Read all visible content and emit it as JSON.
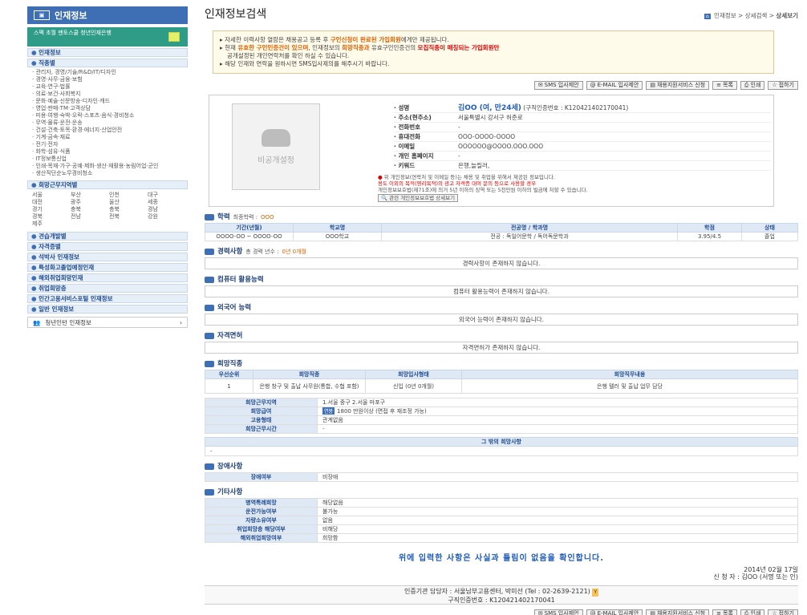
{
  "sidebar": {
    "title": "인재정보",
    "title_icon": "image-icon",
    "banner": "스펙 초월 멘토스쿨 청년인재은행",
    "sections": {
      "talent": "인재정보",
      "job_type": "직종별",
      "region": "희망근무지역별",
      "apprentice": "견습개발별",
      "license": "자격증별",
      "master": "석박사 인재정보",
      "specialized": "특성화고졸업예정인재",
      "overseas": "해외취업희망인재",
      "reemployment": "취업희망층",
      "hanaro": "인간고용서비스포털 인재정보",
      "elderly": "일반 인재정보"
    },
    "job_types": [
      "관리자, 경영/기술/R&D/IT/디자인",
      "경영·사무·금융·보험",
      "교육·연구·법률",
      "의료·보건·사회복지",
      "문화·예술·신문방송·디자인·캐드",
      "영업·판매·TM·고객상담",
      "미용·여행·숙박·오락·스포츠·음식·경비청소",
      "무역·물류·운전·운송",
      "건설·건축·토목·환경·에너지·산업안전",
      "기계·금속·재료",
      "전기·전자",
      "화학·섬유·식품",
      "IT정보통신업",
      "인쇄·목재·가구·공예·제화·생산·재활용·농림어업·군인",
      "생산직단순노무경비청소"
    ],
    "regions": [
      "서울",
      "부산",
      "인천",
      "대구",
      "대전",
      "광주",
      "울산",
      "세종",
      "경기",
      "충북",
      "충북",
      "경남",
      "경북",
      "전남",
      "전북",
      "강원",
      "제주"
    ],
    "youth_link": "청년인턴 인재정보"
  },
  "header": {
    "title": "인재정보검색",
    "breadcrumb": [
      "인재정보",
      "상세검색",
      "상세보기"
    ]
  },
  "notice": {
    "line1_pre": "자세한 이력사항 열람은 채용공고 등록 후",
    "line1_hl": "구인신청이 완료된 가입회원",
    "line1_post": "에게만 제공됩니다.",
    "line2_pre": "현재",
    "line2_hl1": "유효한 구인인증건이 있으며",
    "line2_mid": ", 인재정보의",
    "line2_hl2": "희망직종과",
    "line2_mid2": "유효구인인증건의",
    "line2_hl3": "모집직종이 매칭되는 가입회원만",
    "line2_post": "공개설정된 개인연락처를 확인 하실 수 있습니다.",
    "line3": "해당 인재와 연락을 원하시면 SMS입사제의를 해주시기 바랍니다."
  },
  "buttons": {
    "sms": "SMS 입사제안",
    "email": "E-MAIL 입사제안",
    "support": "채용지원서비스 신청",
    "list": "목록",
    "print": "인쇄",
    "close": "접하기"
  },
  "profile": {
    "photo_label": "비공개설정",
    "name_label": "성명",
    "name_value": "김OO (여, 만24세)",
    "seeker_no": "(구직인증번호 : K120421402170041)",
    "address_label": "주소(현주소)",
    "address_value": "서울특별시 강서구 허준로",
    "phone_label": "전화번호",
    "phone_value": "-",
    "mobile_label": "휴대전화",
    "mobile_value": "OOO-OOOO-OOOO",
    "email_label": "이메일",
    "email_value": "OOOOOO@OOOO.OOO.OOO",
    "public_label": "개인 홈페이지",
    "public_value": "-",
    "keyword_label": "키워드",
    "keyword_value": "은행,늘릴러,",
    "note1": "위 개인정보(연락처 및 이메일 등)는 채용 및 취업을 위해서 제공된 정보입니다.",
    "note2": "용도 이외의 목적(영리목적)의 광고 자격증 대여 문의 등으로 사용할 경우",
    "note3": "개인정보보호법(제71조)에 의거 5년 이하의 징역 또는 5천만원 이하의 벌금에 처할 수 있습니다.",
    "note_btn": "관련 개인정보보호법 상세보기"
  },
  "education": {
    "title": "학력",
    "sub_label": "최종학력 :",
    "sub_value": "OOO",
    "headers": [
      "기간(년월)",
      "학교명",
      "전공명 / 학과명",
      "학점",
      "상태"
    ],
    "rows": [
      [
        "OOOO-OO ~ OOOO-OO",
        "OOO학교",
        "전공 : 독일어문학 / 독어독문학과",
        "3.95/4.5",
        "졸업"
      ]
    ]
  },
  "career": {
    "title": "경력사항",
    "sub_label": "총 경력 년수 :",
    "sub_value": "0년 0개월",
    "empty": "경력사항이 존재하지 않습니다."
  },
  "computer": {
    "title": "컴퓨터 활용능력",
    "empty": "컴퓨터 활용능력이 존재하지 않습니다."
  },
  "language": {
    "title": "외국어 능력",
    "empty": "외국어 능력이 존재하지 않습니다."
  },
  "certificates": {
    "title": "자격면허",
    "empty": "자격면허가 존재하지 않습니다."
  },
  "hope": {
    "title": "희망직종",
    "headers": [
      "우선순위",
      "희망직종",
      "희망입사형태",
      "희망직무내용"
    ],
    "rows": [
      [
        "1",
        "은행 창구 및 출납 사무원(통합, 수협 포함)",
        "신입 (0년 0개월)",
        "은행 텔러 및 출납 업무 담당"
      ]
    ],
    "region_label": "희망근무지역",
    "region_value": "1.서울 중구 2.서울 마포구",
    "salary_label": "희망급여",
    "salary_badge": "연봉",
    "salary_value": "1800 만원이상 (면접 후 재조정 가능)",
    "employ_label": "고용형태",
    "employ_value": "관계없음",
    "time_label": "희망근무시간",
    "time_value": "-",
    "other_label": "그 밖의 희망사항",
    "other_value": "-"
  },
  "disability": {
    "title": "장애사항",
    "label": "장애여부",
    "value": "비장애"
  },
  "etc": {
    "title": "기타사항",
    "rows": [
      {
        "k": "병역특례희망",
        "v": "해당없음"
      },
      {
        "k": "운전가능여부",
        "v": "불가능"
      },
      {
        "k": "자량소유여부",
        "v": "없음"
      },
      {
        "k": "취업희망층 해당여부",
        "v": "비해당"
      },
      {
        "k": "해외취업희망여부",
        "v": "희망함"
      }
    ]
  },
  "confirm": {
    "text": "위에 입력한 사항은 사실과 틀림이 없음을 확인합니다.",
    "date": "2014년 02월 17일",
    "signer": "신 청 자 : 김OO (서명 또는 인)"
  },
  "agency": {
    "line1": "인증기관 담당자 : 서울남부고용센터, 박미선 (Tel : 02-2639-2121)",
    "line2": "구직인증번호 : K120421402170041"
  }
}
